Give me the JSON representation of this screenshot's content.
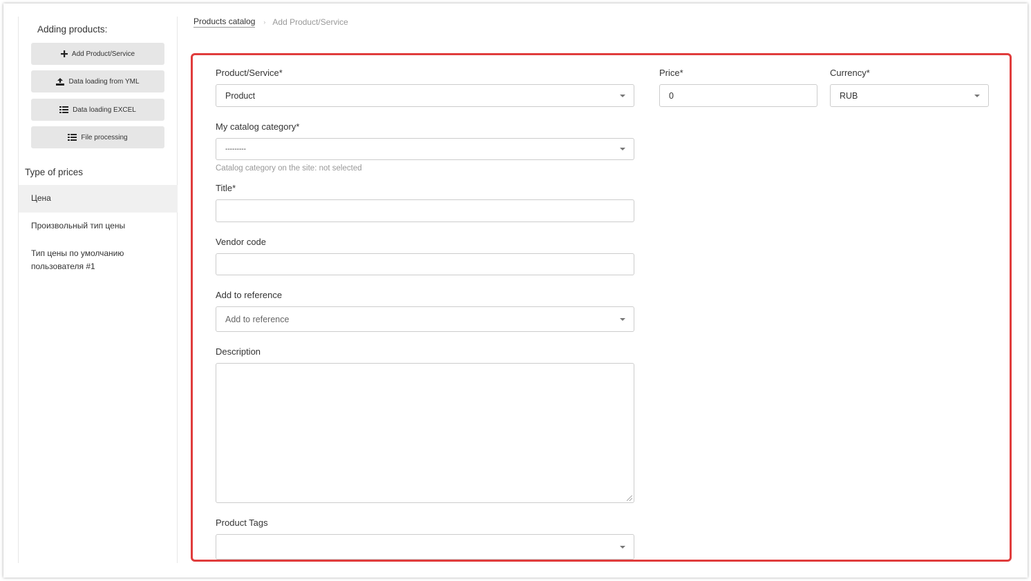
{
  "sidebar": {
    "heading": "Adding products:",
    "buttons": [
      {
        "label": "Add Product/Service",
        "icon": "plus-icon"
      },
      {
        "label": "Data loading from YML",
        "icon": "upload-icon"
      },
      {
        "label": "Data loading EXCEL",
        "icon": "table-icon"
      },
      {
        "label": "File processing",
        "icon": "file-list-icon"
      }
    ],
    "price_types_heading": "Type of prices",
    "price_types": [
      {
        "label": "Цена"
      },
      {
        "label": "Произвольный тип цены"
      },
      {
        "label": "Тип цены по умолчанию"
      },
      {
        "label": "пользователя #1"
      }
    ]
  },
  "breadcrumb": {
    "root": "Products catalog",
    "current": "Add Product/Service"
  },
  "form": {
    "product_service": {
      "label": "Product/Service*",
      "value": "Product"
    },
    "price": {
      "label": "Price*",
      "value": "0"
    },
    "currency": {
      "label": "Currency*",
      "value": "RUB"
    },
    "catalog_category": {
      "label": "My catalog category*",
      "value": "---------",
      "hint": "Catalog category on the site: not selected"
    },
    "title": {
      "label": "Title*",
      "value": ""
    },
    "vendor_code": {
      "label": "Vendor code",
      "value": ""
    },
    "add_to_reference": {
      "label": "Add to reference",
      "placeholder": "Add to reference"
    },
    "description": {
      "label": "Description",
      "value": ""
    },
    "product_tags": {
      "label": "Product Tags",
      "value": ""
    }
  },
  "colors": {
    "highlight_border": "#e03c3c",
    "button_bg": "#e6e6e6"
  }
}
